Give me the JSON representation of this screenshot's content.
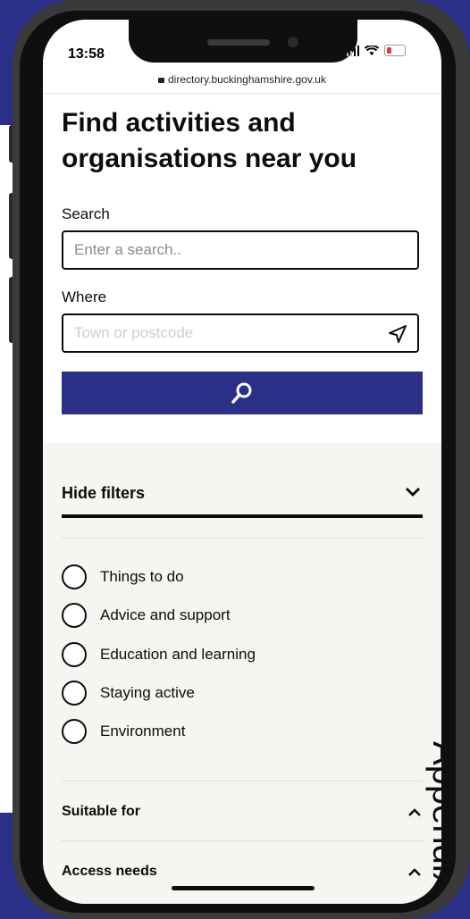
{
  "status_bar": {
    "time": "13:58"
  },
  "browser": {
    "url": "directory.buckinghamshire.gov.uk"
  },
  "page": {
    "title": "Find activities and organisations near you",
    "search": {
      "label": "Search",
      "placeholder": "Enter a search.."
    },
    "where": {
      "label": "Where",
      "placeholder": "Town or postcode"
    }
  },
  "filters": {
    "toggle_label": "Hide filters",
    "categories": [
      "Things to do",
      "Advice and support",
      "Education and learning",
      "Staying active",
      "Environment"
    ],
    "sections": [
      "Suitable for",
      "Access needs"
    ]
  },
  "overlay_text": "Appendix",
  "colors": {
    "brand": "#2a2f88",
    "filter_bg": "#f4f6f1",
    "text": "#0b0c0c"
  }
}
